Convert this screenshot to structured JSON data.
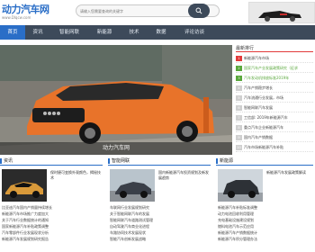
{
  "header": {
    "logo_text": "动力汽车网",
    "logo_sub": "www.Dlqcw.com",
    "search_placeholder": "请输入您需要查询的关键字"
  },
  "nav": {
    "items": [
      "首页",
      "资讯",
      "智能网联",
      "新能源",
      "技术",
      "数据",
      "评论访谈"
    ],
    "active_index": 0
  },
  "hero": {
    "caption": "动力汽车网"
  },
  "sidebar": {
    "title": "最新排行",
    "items": [
      {
        "num": "1",
        "text": "新能源汽车市场"
      },
      {
        "num": "2",
        "text": "国家汽车产业发展政策研究（征求"
      },
      {
        "num": "3",
        "text": "汽车发动机排放标准2019年"
      },
      {
        "num": "4",
        "text": "汽车产销稳步增长"
      },
      {
        "num": "5",
        "text": "汽车流通行业发展，市场"
      },
      {
        "num": "6",
        "text": "智能网联汽车发展"
      },
      {
        "num": "7",
        "text": "工信部: 2019年新能源汽车"
      },
      {
        "num": "8",
        "text": "重点汽车企业新能源汽车"
      },
      {
        "num": "9",
        "text": "国内汽车产销数据"
      },
      {
        "num": "10",
        "text": "汽车市场新能源汽车补贴"
      }
    ]
  },
  "sections": {
    "news": {
      "title": "资讯",
      "feature_title": "保时捷可变换外观颜色，揭秘技术",
      "items": [
        "比亚迪汽车国内产销量持续增长",
        "新能源汽车市场推广力度加大",
        "关于汽车行业数据统计的通知",
        "国家新能源汽车补贴政策调整",
        "汽车零部件行业发展现状分析",
        "新能源汽车发展规划研究报告"
      ]
    },
    "connected": {
      "title": "智能网联",
      "feature_title": "国内新能源汽车投资规划及新发展趋势",
      "items": [
        "车联网行业发展规划研究",
        "关于智能网联汽车的发展",
        "智能网联汽车道路测试管理",
        "自动驾驶汽车商业化进程",
        "车路协同技术发展现状",
        "智能汽车创新发展战略"
      ]
    },
    "ev": {
      "title": "新能源",
      "feature_title": "新能源汽车发展政策解读",
      "items": [
        "新能源汽车补贴标准调整",
        "动力电池回收利用管理",
        "充电基础设施建设规划",
        "燃料电池汽车示范应用",
        "新能源汽车产销数据统计",
        "新能源汽车积分管理办法"
      ]
    }
  },
  "colors": {
    "nav_bg": "#3d4a5a",
    "nav_active": "#2a6ec7",
    "accent_red": "#e23a3a",
    "car_orange": "#e8732a"
  }
}
